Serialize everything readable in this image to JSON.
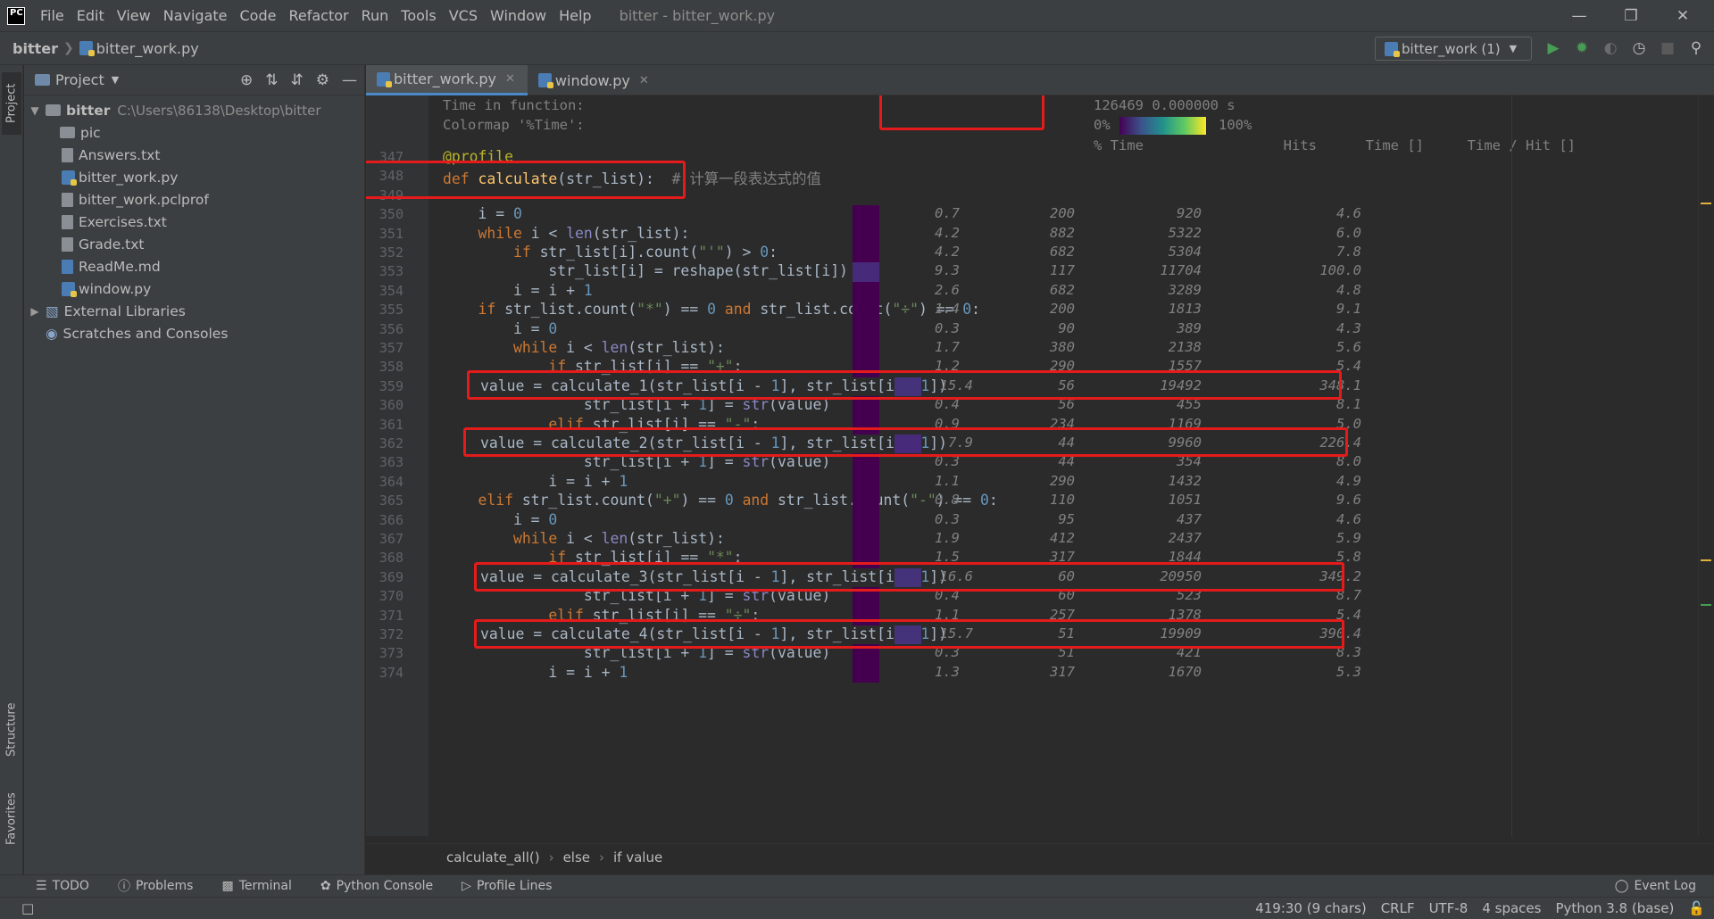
{
  "menu": {
    "items": [
      "File",
      "Edit",
      "View",
      "Navigate",
      "Code",
      "Refactor",
      "Run",
      "Tools",
      "VCS",
      "Window",
      "Help"
    ],
    "title": "bitter - bitter_work.py"
  },
  "nav": {
    "project": "bitter",
    "file": "bitter_work.py",
    "run_config": "bitter_work (1)"
  },
  "project_panel": {
    "title": "Project",
    "root": "bitter",
    "root_path": "C:\\Users\\86138\\Desktop\\bitter",
    "items": [
      "pic",
      "Answers.txt",
      "bitter_work.py",
      "bitter_work.pclprof",
      "Exercises.txt",
      "Grade.txt",
      "ReadMe.md",
      "window.py"
    ],
    "external": "External Libraries",
    "scratches": "Scratches and Consoles"
  },
  "tabs": [
    "bitter_work.py",
    "window.py"
  ],
  "profile_header": {
    "time_label": "Time in function:",
    "colormap_label": "Colormap '%Time':",
    "time_value": "126469 0.000000 s",
    "pct_min": "0%",
    "pct_max": "100%",
    "col_time_pct": "% Time",
    "col_hits": "Hits",
    "col_time": "Time []",
    "col_per_hit": "Time / Hit []"
  },
  "inspection_count": "2",
  "lines": [
    {
      "n": "347",
      "pct": "",
      "hits": "",
      "time": "",
      "per": ""
    },
    {
      "n": "348",
      "pct": "",
      "hits": "",
      "time": "",
      "per": ""
    },
    {
      "n": "349",
      "pct": "",
      "hits": "",
      "time": "",
      "per": ""
    },
    {
      "n": "350",
      "pct": "0.7",
      "hits": "200",
      "time": "920",
      "per": "4.6"
    },
    {
      "n": "351",
      "pct": "4.2",
      "hits": "882",
      "time": "5322",
      "per": "6.0"
    },
    {
      "n": "352",
      "pct": "4.2",
      "hits": "682",
      "time": "5304",
      "per": "7.8"
    },
    {
      "n": "353",
      "pct": "9.3",
      "hits": "117",
      "time": "11704",
      "per": "100.0"
    },
    {
      "n": "354",
      "pct": "2.6",
      "hits": "682",
      "time": "3289",
      "per": "4.8"
    },
    {
      "n": "355",
      "pct": "1.4",
      "hits": "200",
      "time": "1813",
      "per": "9.1"
    },
    {
      "n": "356",
      "pct": "0.3",
      "hits": "90",
      "time": "389",
      "per": "4.3"
    },
    {
      "n": "357",
      "pct": "1.7",
      "hits": "380",
      "time": "2138",
      "per": "5.6"
    },
    {
      "n": "358",
      "pct": "1.2",
      "hits": "290",
      "time": "1557",
      "per": "5.4"
    },
    {
      "n": "359",
      "pct": "15.4",
      "hits": "56",
      "time": "19492",
      "per": "348.1"
    },
    {
      "n": "360",
      "pct": "0.4",
      "hits": "56",
      "time": "455",
      "per": "8.1"
    },
    {
      "n": "361",
      "pct": "0.9",
      "hits": "234",
      "time": "1169",
      "per": "5.0"
    },
    {
      "n": "362",
      "pct": "7.9",
      "hits": "44",
      "time": "9960",
      "per": "226.4"
    },
    {
      "n": "363",
      "pct": "0.3",
      "hits": "44",
      "time": "354",
      "per": "8.0"
    },
    {
      "n": "364",
      "pct": "1.1",
      "hits": "290",
      "time": "1432",
      "per": "4.9"
    },
    {
      "n": "365",
      "pct": "0.8",
      "hits": "110",
      "time": "1051",
      "per": "9.6"
    },
    {
      "n": "366",
      "pct": "0.3",
      "hits": "95",
      "time": "437",
      "per": "4.6"
    },
    {
      "n": "367",
      "pct": "1.9",
      "hits": "412",
      "time": "2437",
      "per": "5.9"
    },
    {
      "n": "368",
      "pct": "1.5",
      "hits": "317",
      "time": "1844",
      "per": "5.8"
    },
    {
      "n": "369",
      "pct": "16.6",
      "hits": "60",
      "time": "20950",
      "per": "349.2"
    },
    {
      "n": "370",
      "pct": "0.4",
      "hits": "60",
      "time": "523",
      "per": "8.7"
    },
    {
      "n": "371",
      "pct": "1.1",
      "hits": "257",
      "time": "1378",
      "per": "5.4"
    },
    {
      "n": "372",
      "pct": "15.7",
      "hits": "51",
      "time": "19909",
      "per": "390.4"
    },
    {
      "n": "373",
      "pct": "0.3",
      "hits": "51",
      "time": "421",
      "per": "8.3"
    },
    {
      "n": "374",
      "pct": "1.3",
      "hits": "317",
      "time": "1670",
      "per": "5.3"
    }
  ],
  "code": {
    "l347": "@profile",
    "l348_comment": "# 计算一段表达式的值"
  },
  "code_breadcrumb": [
    "calculate_all()",
    "else",
    "if value"
  ],
  "tool_windows": [
    "TODO",
    "Problems",
    "Terminal",
    "Python Console",
    "Profile Lines"
  ],
  "event_log": "Event Log",
  "status": {
    "position": "419:30 (9 chars)",
    "line_sep": "CRLF",
    "encoding": "UTF-8",
    "indent": "4 spaces",
    "interpreter": "Python 3.8 (base)"
  },
  "left_strip": [
    "Project",
    "Structure",
    "Favorites"
  ],
  "colors": {
    "accent": "#4a88c7",
    "highlight_box": "#e51b1b",
    "profile_marker": "#6b1fa0"
  }
}
